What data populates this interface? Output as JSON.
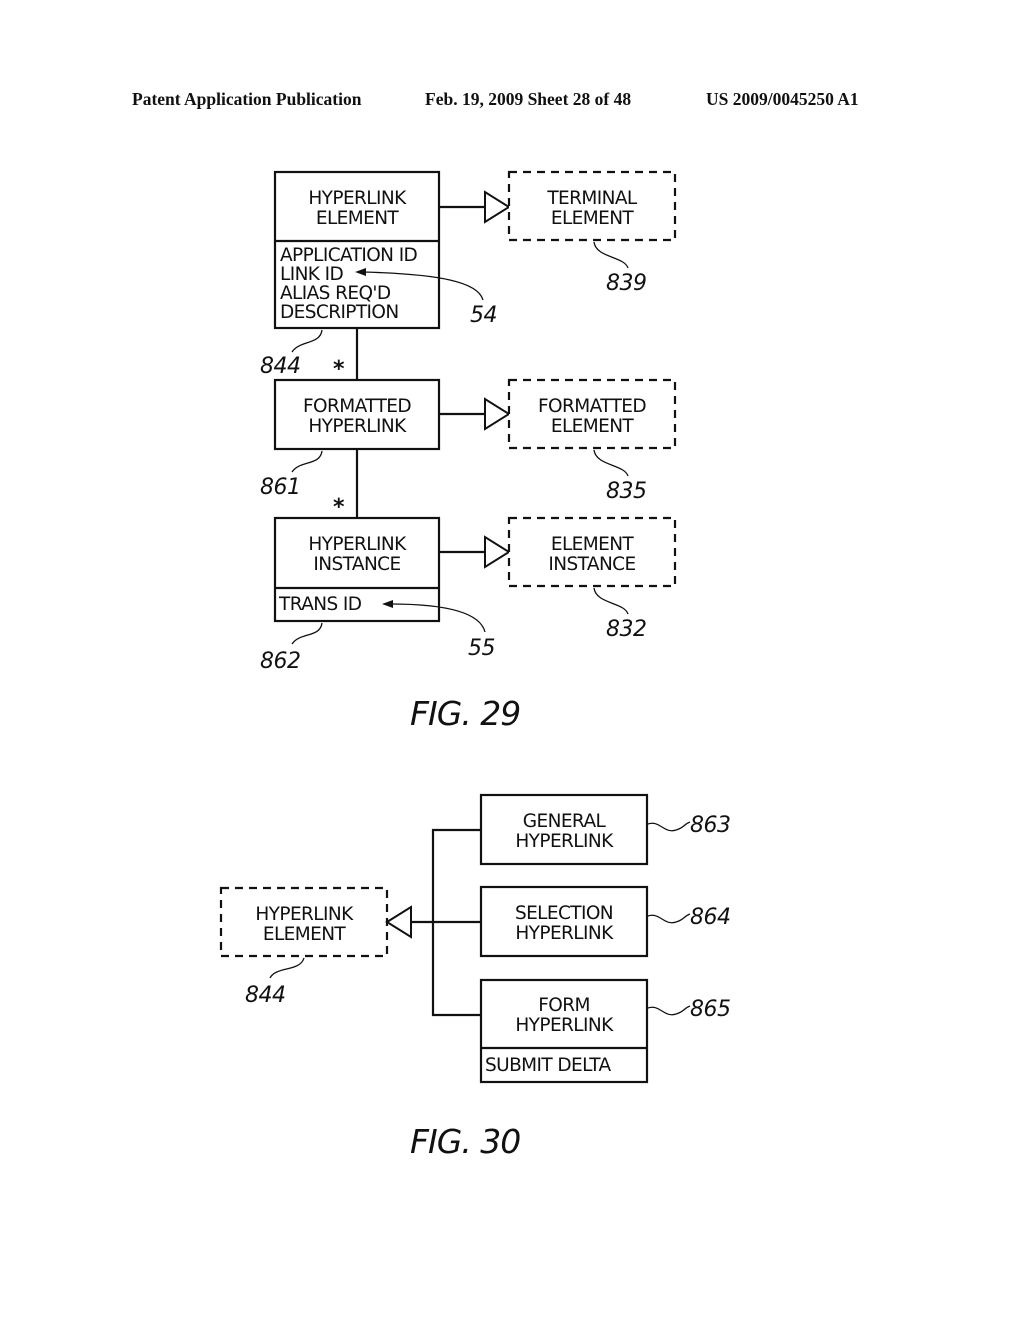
{
  "header": {
    "publication": "Patent Application Publication",
    "date_sheet": "Feb. 19, 2009  Sheet 28 of 48",
    "number": "US 2009/0045250 A1"
  },
  "fig29": {
    "caption": "FIG. 29",
    "hyperlink_element": {
      "title": [
        "HYPERLINK",
        "ELEMENT"
      ],
      "attributes": [
        "APPLICATION ID",
        "LINK ID",
        "ALIAS REQ'D",
        "DESCRIPTION"
      ],
      "ref": "844"
    },
    "terminal_element": {
      "title": [
        "TERMINAL",
        "ELEMENT"
      ],
      "ref": "839"
    },
    "formatted_hyperlink": {
      "title": [
        "FORMATTED",
        "HYPERLINK"
      ],
      "ref": "861"
    },
    "formatted_element": {
      "title": [
        "FORMATTED",
        "ELEMENT"
      ],
      "ref": "835"
    },
    "hyperlink_instance": {
      "title": [
        "HYPERLINK",
        "INSTANCE"
      ],
      "attributes": [
        "TRANS ID"
      ],
      "ref": "862"
    },
    "element_instance": {
      "title": [
        "ELEMENT",
        "INSTANCE"
      ],
      "ref": "832"
    },
    "link_id_ref": "54",
    "trans_id_ref": "55",
    "multiplicity_1": "*",
    "multiplicity_2": "*"
  },
  "fig30": {
    "caption": "FIG. 30",
    "hyperlink_element": {
      "title": [
        "HYPERLINK",
        "ELEMENT"
      ],
      "ref": "844"
    },
    "general_hyperlink": {
      "title": [
        "GENERAL",
        "HYPERLINK"
      ],
      "ref": "863"
    },
    "selection_hyperlink": {
      "title": [
        "SELECTION",
        "HYPERLINK"
      ],
      "ref": "864"
    },
    "form_hyperlink": {
      "title": [
        "FORM",
        "HYPERLINK"
      ],
      "attributes": [
        "SUBMIT DELTA"
      ],
      "ref": "865"
    }
  }
}
